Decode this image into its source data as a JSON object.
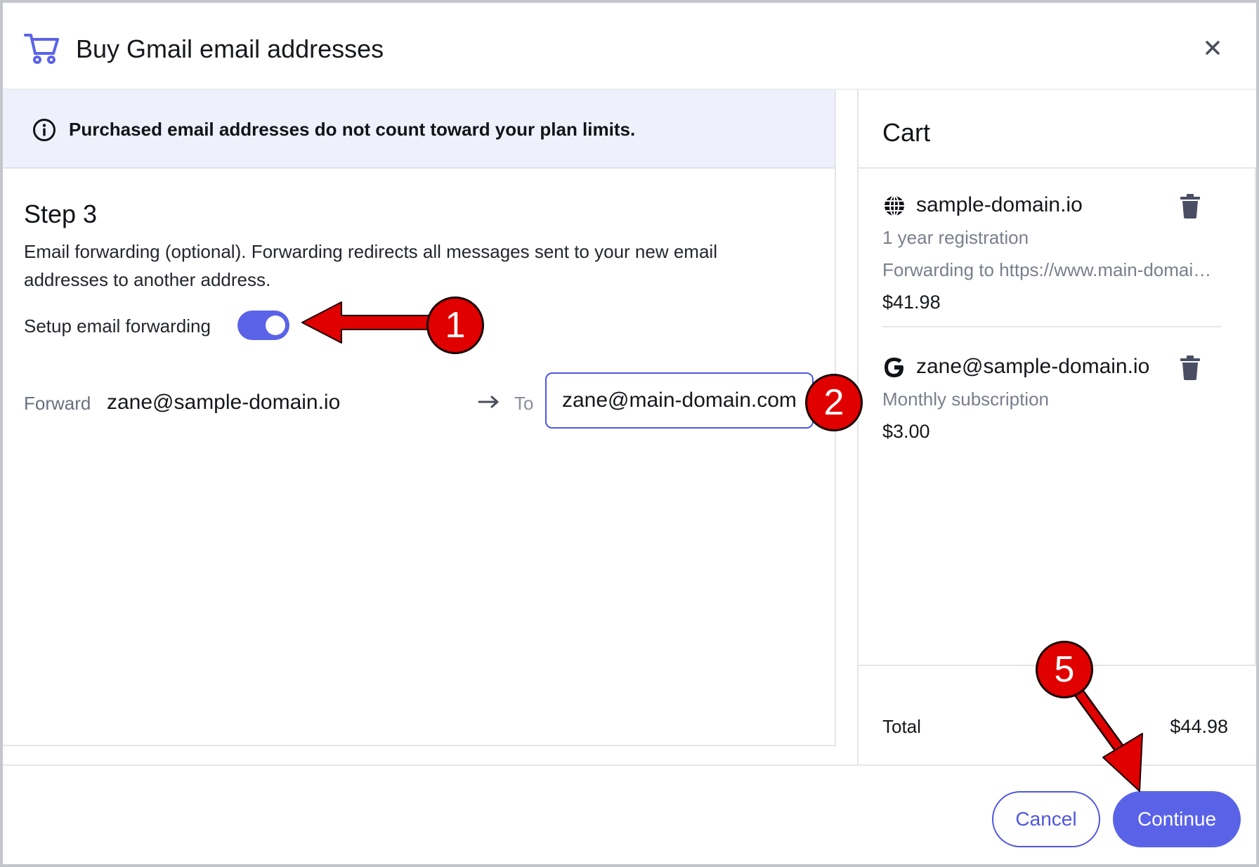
{
  "header": {
    "title": "Buy Gmail email addresses",
    "close_glyph": "×",
    "accent_color": "#5a63e8"
  },
  "banner": {
    "text": "Purchased email addresses do not count toward your plan limits."
  },
  "step": {
    "title": "Step 3",
    "description": "Email forwarding (optional). Forwarding redirects all messages sent to your new email addresses to another address.",
    "toggle_label": "Setup email forwarding",
    "toggle_on": true
  },
  "forwarding": {
    "forward_label": "Forward",
    "from_address": "zane@sample-domain.io",
    "to_label": "To",
    "to_value": "zane@main-domain.com"
  },
  "cart": {
    "title": "Cart",
    "items": [
      {
        "name": "sample-domain.io",
        "icon": "globe-icon",
        "subtitle": "1 year registration",
        "detail": "Forwarding to https://www.main-domain.com",
        "price": "$41.98"
      },
      {
        "name": "zane@sample-domain.io",
        "icon": "google-icon",
        "subtitle": "Monthly subscription",
        "price": "$3.00"
      }
    ],
    "total_label": "Total",
    "total_value": "$44.98"
  },
  "footer": {
    "cancel_label": "Cancel",
    "continue_label": "Continue"
  },
  "annotations": {
    "badge_1": "1",
    "badge_2": "2",
    "badge_5": "5",
    "color": "#e00000"
  }
}
